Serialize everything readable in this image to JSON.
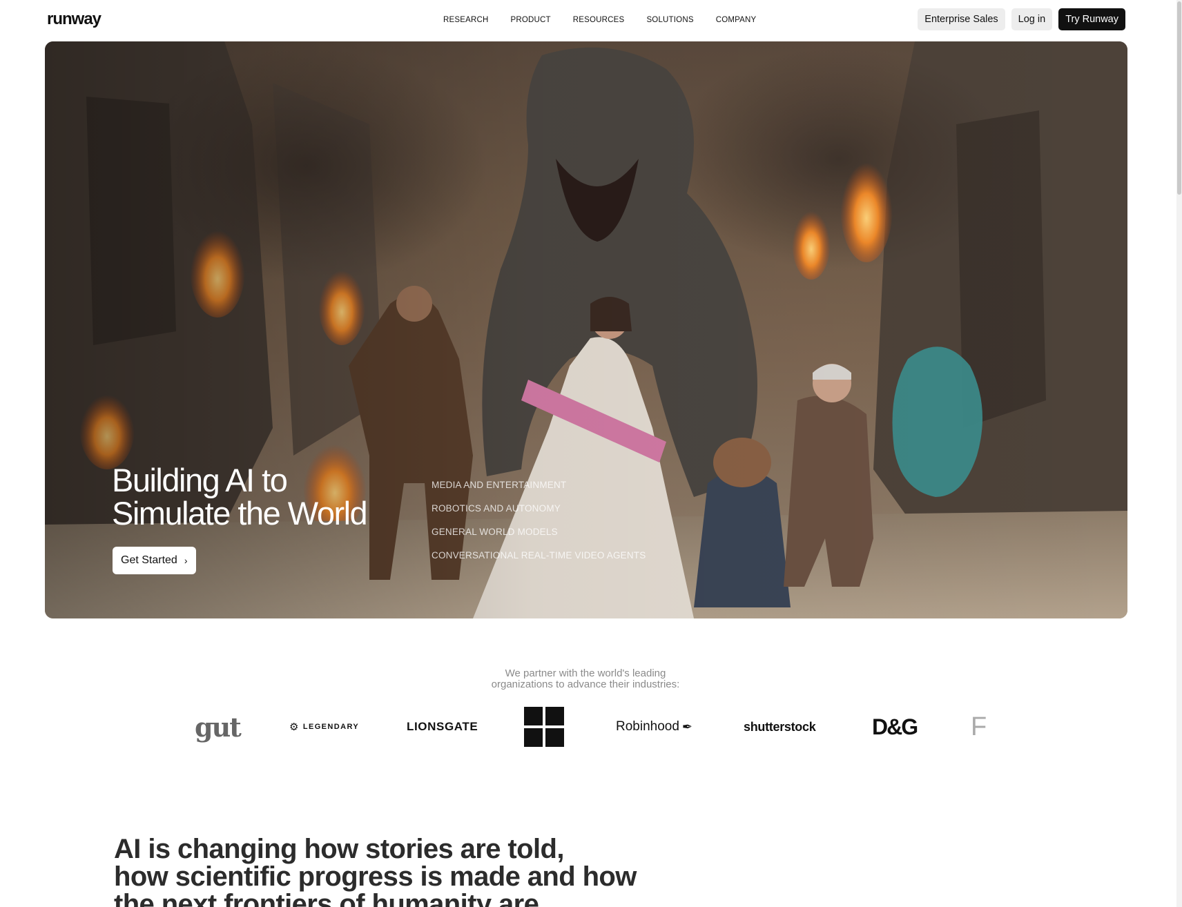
{
  "header": {
    "logo": "runway",
    "nav": [
      "RESEARCH",
      "PRODUCT",
      "RESOURCES",
      "SOLUTIONS",
      "COMPANY"
    ],
    "enterprise_label": "Enterprise Sales",
    "login_label": "Log in",
    "try_label": "Try Runway"
  },
  "hero": {
    "title_line1": "Building AI to",
    "title_line2": "Simulate the World",
    "cta_label": "Get Started",
    "links": [
      "MEDIA AND ENTERTAINMENT",
      "ROBOTICS AND AUTONOMY",
      "GENERAL WORLD MODELS",
      "CONVERSATIONAL REAL-TIME VIDEO AGENTS"
    ]
  },
  "partners": {
    "line1": "We partner with the world's leading",
    "line2": "organizations to advance their industries:",
    "logos": [
      "gut",
      "LEGENDARY",
      "LIONSGATE",
      "Microsoft",
      "Robinhood",
      "shutterstock",
      "D&G",
      "F"
    ]
  },
  "statement": {
    "line1": "AI is changing how stories are told,",
    "line2": "how scientific progress is made and how",
    "line3": "the next frontiers of humanity are reached."
  },
  "colors": {
    "dark_button": "#111111",
    "light_button": "#ededed",
    "muted_text": "#8a8a8a"
  }
}
